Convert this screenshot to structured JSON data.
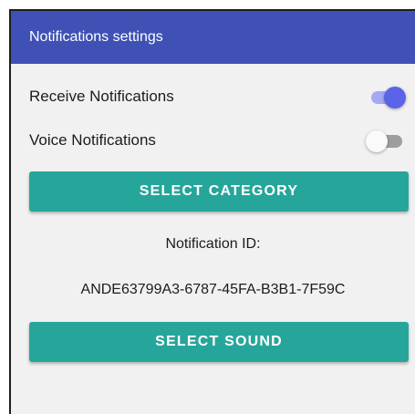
{
  "appbar": {
    "title": "Notifications settings"
  },
  "settings": {
    "receive": {
      "label": "Receive Notifications",
      "enabled": true
    },
    "voice": {
      "label": "Voice Notifications",
      "enabled": false
    }
  },
  "buttons": {
    "select_category": "SELECT CATEGORY",
    "select_sound": "SELECT SOUND"
  },
  "notification": {
    "id_label": "Notification ID:",
    "id_value": "ANDE63799A3-6787-45FA-B3B1-7F59C"
  },
  "colors": {
    "appbar": "#3f51b5",
    "accent_button": "#26a69a",
    "switch_on": "#5b63e8"
  }
}
